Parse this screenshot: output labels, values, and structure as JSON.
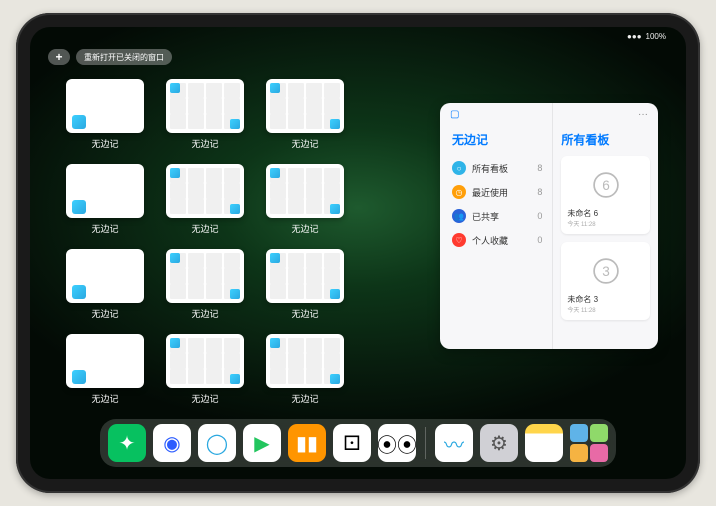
{
  "status": {
    "battery": "100%",
    "wifi": "●●●"
  },
  "topbar": {
    "plus": "+",
    "reopen_label": "重新打开已关闭的窗口"
  },
  "app_cards": [
    {
      "label": "无边记",
      "kind": "blank"
    },
    {
      "label": "无边记",
      "kind": "grid"
    },
    {
      "label": "无边记",
      "kind": "grid"
    },
    {
      "label": "无边记",
      "kind": "blank"
    },
    {
      "label": "无边记",
      "kind": "grid"
    },
    {
      "label": "无边记",
      "kind": "grid"
    },
    {
      "label": "无边记",
      "kind": "blank"
    },
    {
      "label": "无边记",
      "kind": "grid"
    },
    {
      "label": "无边记",
      "kind": "grid"
    },
    {
      "label": "无边记",
      "kind": "blank"
    },
    {
      "label": "无边记",
      "kind": "grid"
    },
    {
      "label": "无边记",
      "kind": "grid"
    }
  ],
  "panel": {
    "app_title": "无边记",
    "right_title": "所有看板",
    "more": "···",
    "menu": [
      {
        "icon": "○",
        "color": "#2fb4e8",
        "label": "所有看板",
        "count": "8"
      },
      {
        "icon": "◷",
        "color": "#ff9f0a",
        "label": "最近使用",
        "count": "8"
      },
      {
        "icon": "👥",
        "color": "#2a62d9",
        "label": "已共享",
        "count": "0"
      },
      {
        "icon": "♡",
        "color": "#ff3b30",
        "label": "个人收藏",
        "count": "0"
      }
    ],
    "boards": [
      {
        "name": "未命名 6",
        "date": "今天 11:28",
        "digit": "6"
      },
      {
        "name": "未命名 3",
        "date": "今天 11:28",
        "digit": "3"
      }
    ]
  },
  "dock": {
    "items": [
      {
        "name": "wechat",
        "bg": "#07c160",
        "glyph": "✦"
      },
      {
        "name": "browser1",
        "bg": "#ffffff",
        "glyph": "◉",
        "fg": "#2b5cff"
      },
      {
        "name": "browser2",
        "bg": "#ffffff",
        "glyph": "◯",
        "fg": "#2aa8e0"
      },
      {
        "name": "play",
        "bg": "#ffffff",
        "glyph": "▶",
        "fg": "#22c55e"
      },
      {
        "name": "books",
        "bg": "#ff9500",
        "glyph": "▮▮",
        "fg": "#fff"
      },
      {
        "name": "dice",
        "bg": "#ffffff",
        "glyph": "⚀",
        "fg": "#000"
      },
      {
        "name": "connect",
        "bg": "#ffffff",
        "glyph": "⦿⦿",
        "fg": "#000"
      }
    ],
    "recent": [
      {
        "name": "freeform",
        "bg": "#ffffff",
        "glyph": "〰",
        "fg": "#2aa8e0"
      },
      {
        "name": "settings",
        "bg": "#d0d0d5",
        "glyph": "⚙",
        "fg": "#555"
      },
      {
        "name": "notes",
        "bg": "linear-gradient(180deg,#ffd54a 25%,#ffffff 25%)",
        "glyph": "",
        "fg": "#333"
      }
    ]
  }
}
